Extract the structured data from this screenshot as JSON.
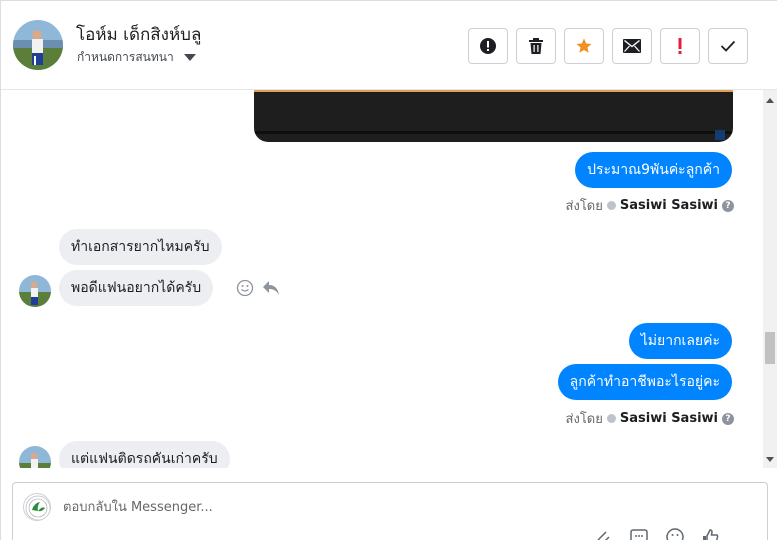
{
  "header": {
    "contact_name": "โอห์ม เด็กสิงห์บลู",
    "assign_label": "กำหนดการสนทนา",
    "actions": [
      {
        "name": "mark-spam-button",
        "icon": "exclamation-circle-icon"
      },
      {
        "name": "delete-button",
        "icon": "trash-icon"
      },
      {
        "name": "star-button",
        "icon": "star-icon"
      },
      {
        "name": "mark-unread-button",
        "icon": "envelope-icon"
      },
      {
        "name": "follow-up-button",
        "icon": "exclamation-icon"
      },
      {
        "name": "mark-done-button",
        "icon": "check-icon"
      }
    ]
  },
  "messages": {
    "out_1": "ประมาณ9พันค่ะลูกค้า",
    "sentby_1_prefix": "ส่งโดย",
    "sentby_1_name": "Sasiwi Sasiwi",
    "in_1": "ทำเอกสารยากไหมครับ",
    "in_2": "พอดีแฟนอยากได้ครับ",
    "out_2": "ไม่ยากเลยค่ะ",
    "out_3": "ลูกค้าทำอาชีพอะไรอยู่คะ",
    "sentby_2_prefix": "ส่งโดย",
    "sentby_2_name": "Sasiwi Sasiwi",
    "in_3": "แต่แฟนติดรถคันเก่าครับ"
  },
  "composer": {
    "placeholder": "ตอบกลับใน Messenger..."
  },
  "colors": {
    "outgoing_bubble": "#0084ff",
    "incoming_bubble": "#eceef1",
    "star": "#f08f22",
    "flag": "#e41e3f"
  }
}
